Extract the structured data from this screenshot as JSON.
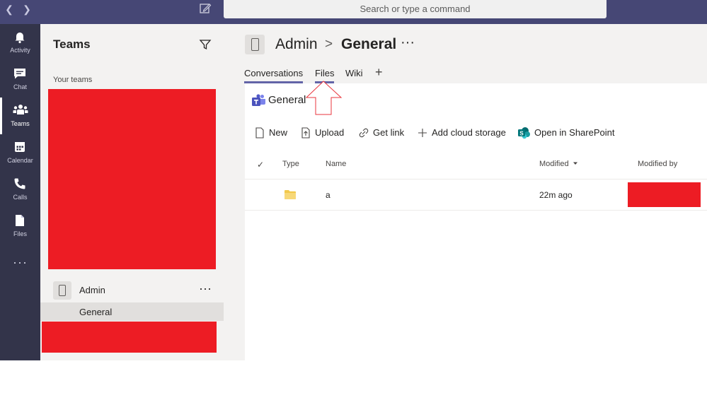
{
  "window": {
    "search_placeholder": "Search or type a command"
  },
  "rail": {
    "items": [
      {
        "label": "Activity",
        "icon": "bell-icon"
      },
      {
        "label": "Chat",
        "icon": "chat-icon"
      },
      {
        "label": "Teams",
        "icon": "teams-icon",
        "active": true
      },
      {
        "label": "Calendar",
        "icon": "calendar-icon"
      },
      {
        "label": "Calls",
        "icon": "phone-icon"
      },
      {
        "label": "Files",
        "icon": "file-icon"
      }
    ],
    "more": "···"
  },
  "panel": {
    "title": "Teams",
    "section_label": "Your teams",
    "team": {
      "name": "Admin",
      "more": "···"
    },
    "channel": {
      "name": "General"
    },
    "redaction_color": "#ed1c24"
  },
  "main": {
    "breadcrumb": {
      "team": "Admin",
      "separator": ">",
      "channel": "General",
      "more": "···"
    },
    "tabs": [
      {
        "label": "Conversations"
      },
      {
        "label": "Files",
        "active": true
      },
      {
        "label": "Wiki"
      }
    ],
    "tab_add": "+",
    "library_title": "General",
    "commands": [
      {
        "label": "New",
        "icon": "new-file-icon"
      },
      {
        "label": "Upload",
        "icon": "upload-icon"
      },
      {
        "label": "Get link",
        "icon": "link-icon"
      },
      {
        "label": "Add cloud storage",
        "icon": "plus-icon"
      },
      {
        "label": "Open in SharePoint",
        "icon": "sharepoint-icon"
      }
    ],
    "columns": {
      "check": "✓",
      "type": "Type",
      "name": "Name",
      "modified": "Modified",
      "modified_by": "Modified by"
    },
    "rows": [
      {
        "type_icon": "folder-icon",
        "name": "a",
        "modified": "22m ago"
      }
    ]
  },
  "colors": {
    "titlebar": "#464775",
    "rail": "#33344a",
    "accent": "#6264a7",
    "folder": "#f2c94c"
  }
}
